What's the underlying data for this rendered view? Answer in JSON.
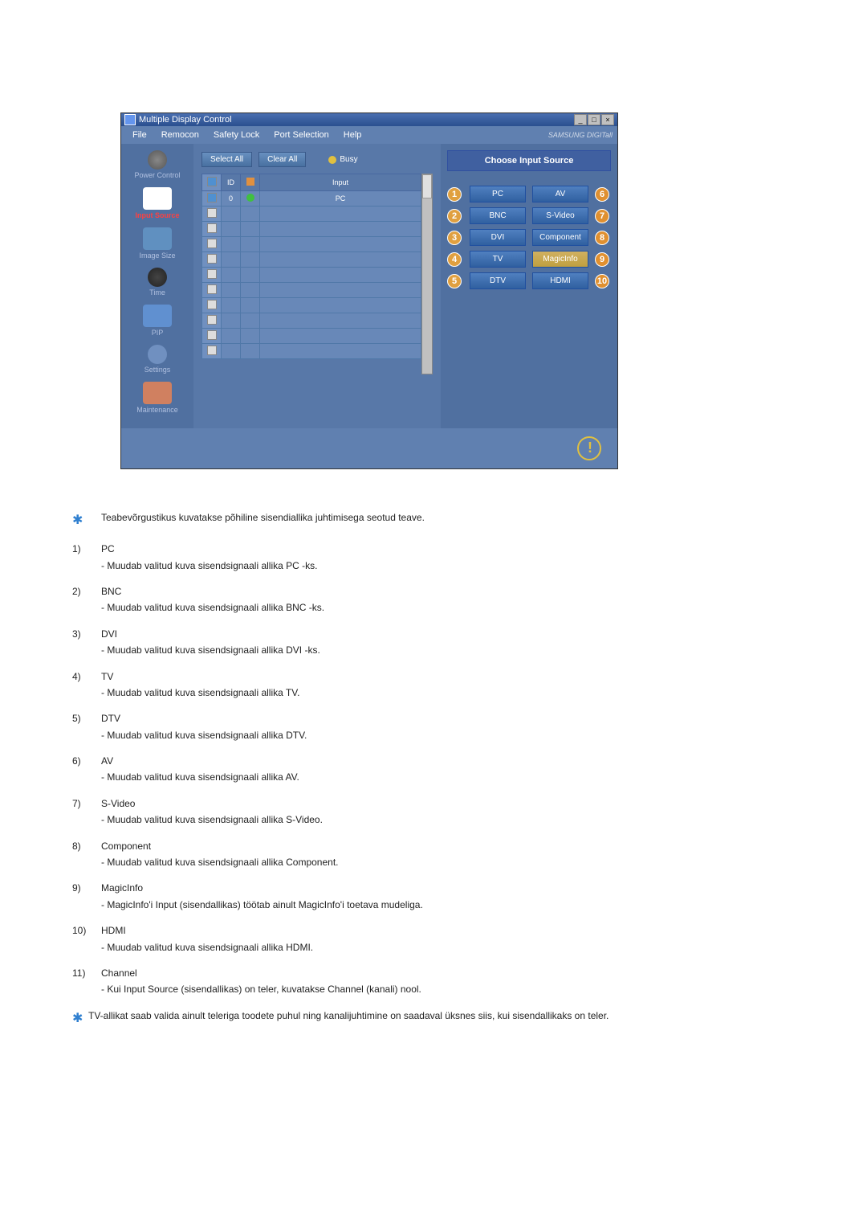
{
  "window": {
    "title": "Multiple Display Control",
    "menubar": [
      "File",
      "Remocon",
      "Safety Lock",
      "Port Selection",
      "Help"
    ],
    "brand": "SAMSUNG DIGITall"
  },
  "sidebar": {
    "items": [
      {
        "label": "Power Control"
      },
      {
        "label": "Input Source"
      },
      {
        "label": "Image Size"
      },
      {
        "label": "Time"
      },
      {
        "label": "PIP"
      },
      {
        "label": "Settings"
      },
      {
        "label": "Maintenance"
      }
    ]
  },
  "toolbar": {
    "select_all": "Select All",
    "clear_all": "Clear All",
    "busy": "Busy"
  },
  "table": {
    "headers": {
      "cb": "☑",
      "id": "ID",
      "status": "●",
      "input": "Input"
    },
    "rows": [
      {
        "checked": true,
        "id": "0",
        "status": "green",
        "input": "PC"
      },
      {
        "checked": false,
        "id": "",
        "status": "",
        "input": ""
      },
      {
        "checked": false,
        "id": "",
        "status": "",
        "input": ""
      },
      {
        "checked": false,
        "id": "",
        "status": "",
        "input": ""
      },
      {
        "checked": false,
        "id": "",
        "status": "",
        "input": ""
      },
      {
        "checked": false,
        "id": "",
        "status": "",
        "input": ""
      },
      {
        "checked": false,
        "id": "",
        "status": "",
        "input": ""
      },
      {
        "checked": false,
        "id": "",
        "status": "",
        "input": ""
      },
      {
        "checked": false,
        "id": "",
        "status": "",
        "input": ""
      },
      {
        "checked": false,
        "id": "",
        "status": "",
        "input": ""
      },
      {
        "checked": false,
        "id": "",
        "status": "",
        "input": ""
      }
    ]
  },
  "right_panel": {
    "header": "Choose Input Source",
    "left_sources": [
      {
        "num": "1",
        "label": "PC"
      },
      {
        "num": "2",
        "label": "BNC"
      },
      {
        "num": "3",
        "label": "DVI"
      },
      {
        "num": "4",
        "label": "TV"
      },
      {
        "num": "5",
        "label": "DTV"
      }
    ],
    "right_sources": [
      {
        "num": "6",
        "label": "AV"
      },
      {
        "num": "7",
        "label": "S-Video"
      },
      {
        "num": "8",
        "label": "Component"
      },
      {
        "num": "9",
        "label": "MagicInfo"
      },
      {
        "num": "10",
        "label": "HDMI"
      }
    ]
  },
  "doc": {
    "intro": "Teabevõrgustikus kuvatakse põhiline sisendiallika juhtimisega seotud teave.",
    "items": [
      {
        "num": "1)",
        "title": "PC",
        "desc": "- Muudab valitud kuva sisendsignaali allika PC -ks."
      },
      {
        "num": "2)",
        "title": "BNC",
        "desc": "- Muudab valitud kuva sisendsignaali allika BNC -ks."
      },
      {
        "num": "3)",
        "title": "DVI",
        "desc": "- Muudab valitud kuva sisendsignaali allika DVI -ks."
      },
      {
        "num": "4)",
        "title": "TV",
        "desc": "- Muudab valitud kuva sisendsignaali allika TV."
      },
      {
        "num": "5)",
        "title": "DTV",
        "desc": "- Muudab valitud kuva sisendsignaali allika DTV."
      },
      {
        "num": "6)",
        "title": "AV",
        "desc": "- Muudab valitud kuva sisendsignaali allika AV."
      },
      {
        "num": "7)",
        "title": "S-Video",
        "desc": "- Muudab valitud kuva sisendsignaali allika S-Video."
      },
      {
        "num": "8)",
        "title": "Component",
        "desc": "- Muudab valitud kuva sisendsignaali allika Component."
      },
      {
        "num": "9)",
        "title": "MagicInfo",
        "desc": "- MagicInfo'i Input (sisendallikas) töötab ainult MagicInfo'i toetava mudeliga."
      },
      {
        "num": "10)",
        "title": "HDMI",
        "desc": "- Muudab valitud kuva sisendsignaali allika HDMI."
      },
      {
        "num": "11)",
        "title": "Channel",
        "desc": "- Kui Input Source (sisendallikas) on teler, kuvatakse Channel (kanali) nool."
      }
    ],
    "note": "TV-allikat saab valida ainult teleriga toodete puhul ning kanalijuhtimine on saadaval üksnes siis, kui sisendallikaks on teler."
  }
}
